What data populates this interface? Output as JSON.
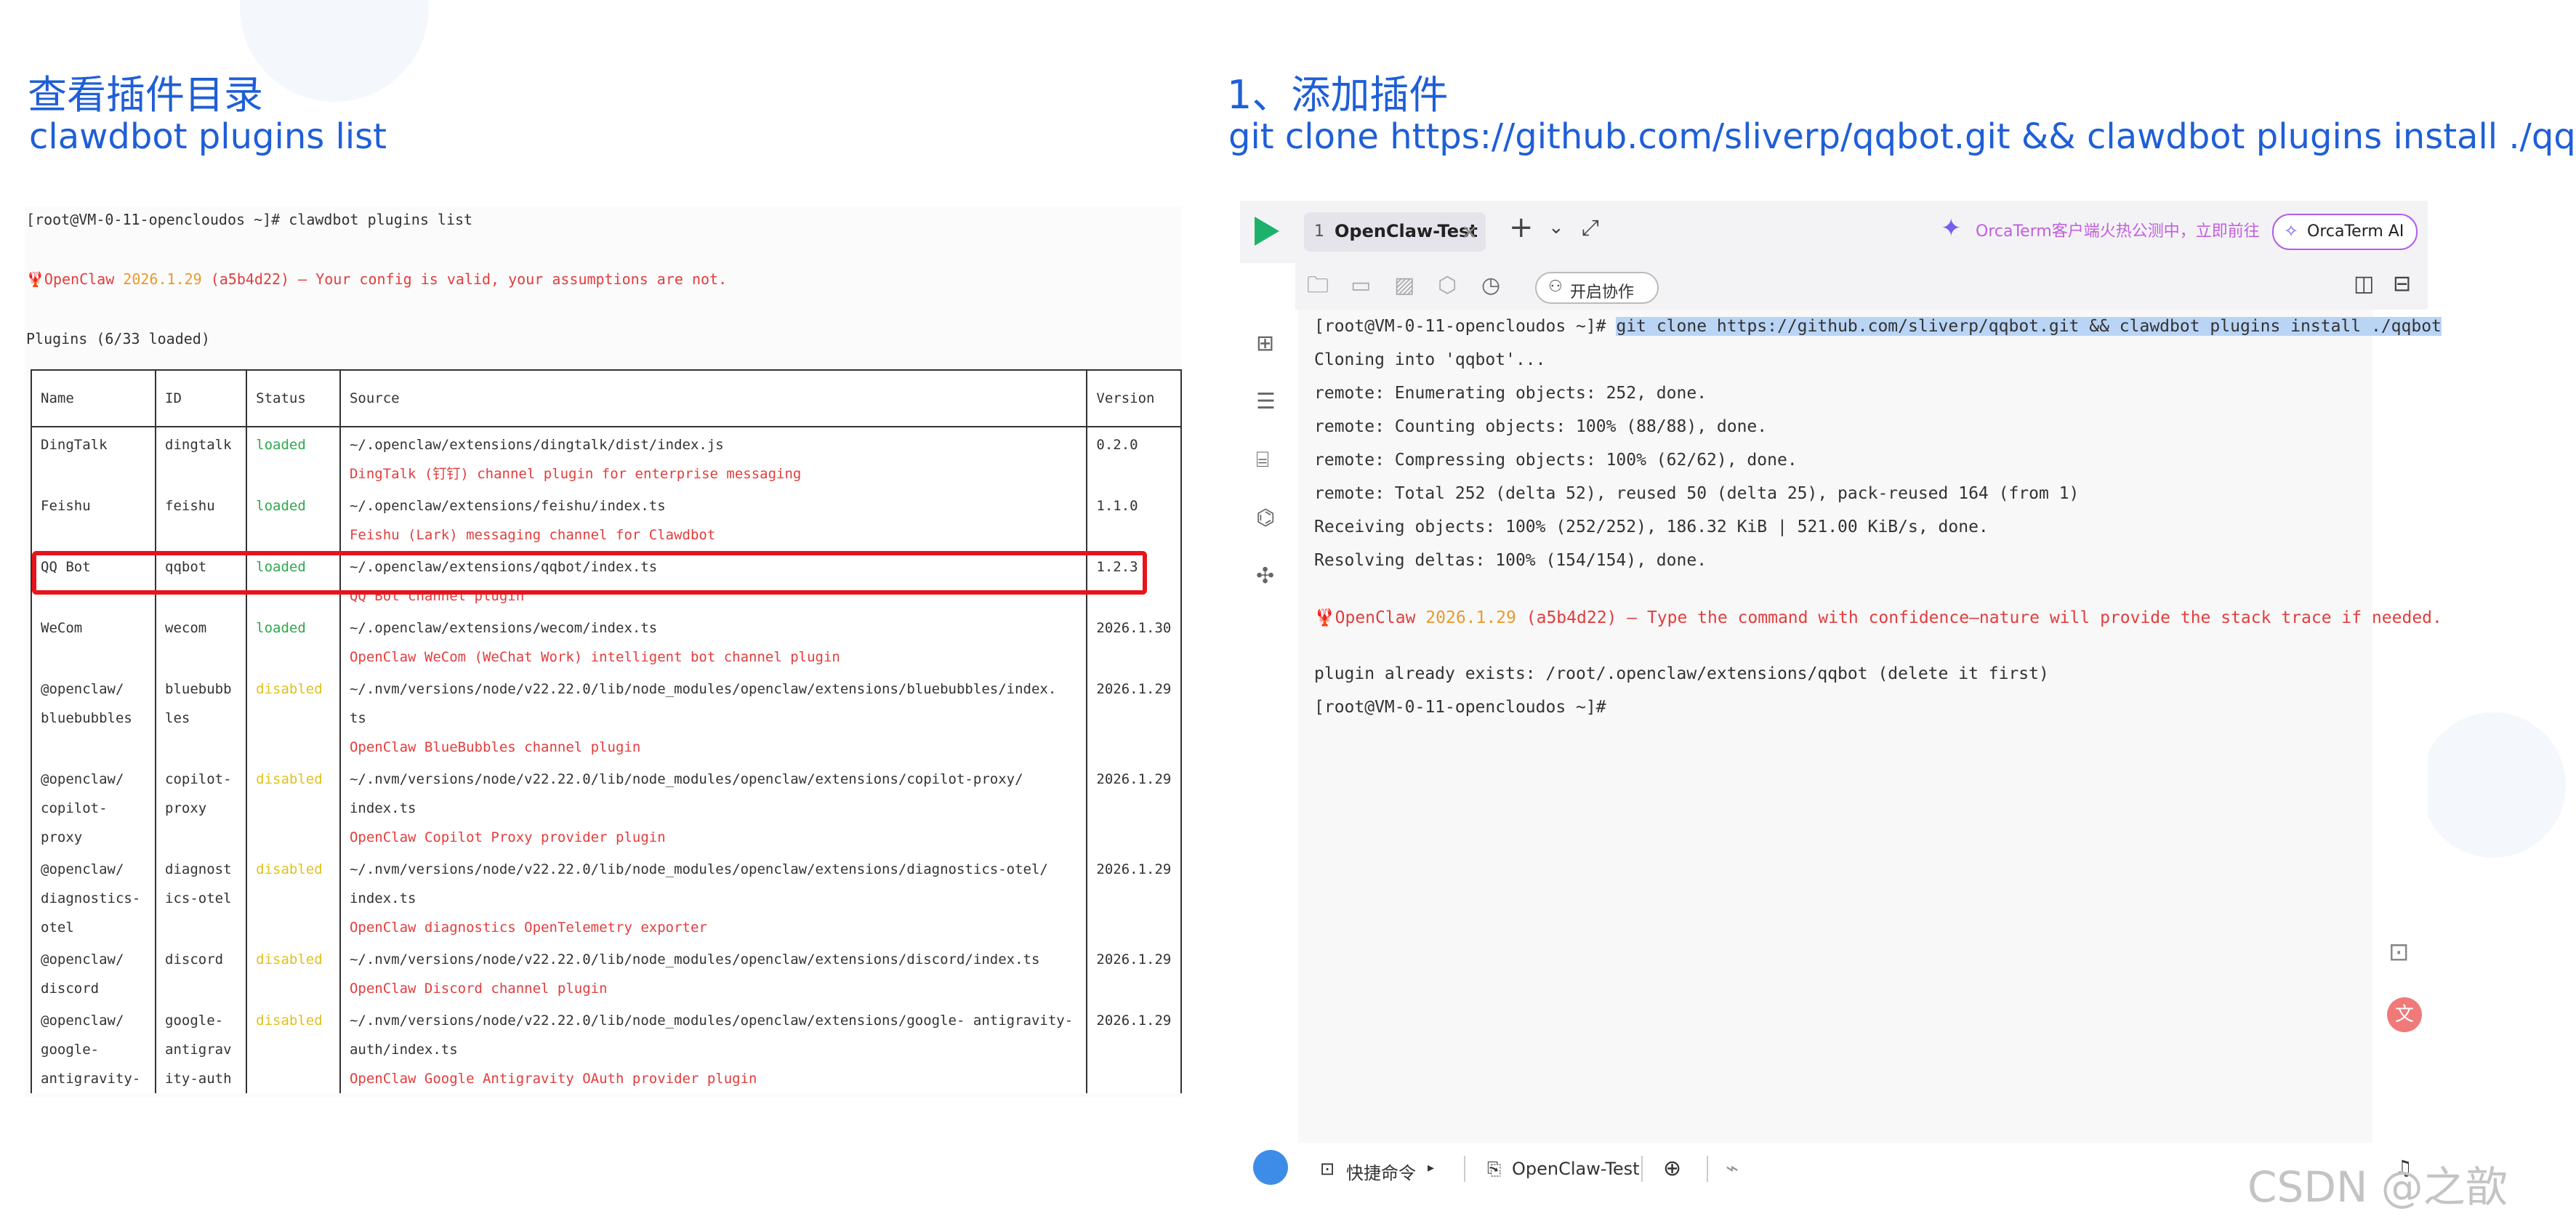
{
  "left": {
    "heading_cn": "查看插件目录",
    "heading_cmd": "clawdbot plugins list",
    "terminal": {
      "prompt_cmd": "[root@VM-0-11-opencloudos ~]# clawdbot plugins list",
      "config_line_prefix": "🦞OpenClaw",
      "config_version": "2026.1.29",
      "config_hash": "(a5b4d22)",
      "config_msg": "— Your config is valid, your assumptions are not.",
      "plugins_loaded": "Plugins (6/33 loaded)"
    },
    "table": {
      "headers": [
        "Name",
        "ID",
        "Status",
        "Source",
        "Version"
      ],
      "rows": [
        {
          "name": "DingTalk",
          "id": "dingtalk",
          "status": "loaded",
          "source": "~/.openclaw/extensions/dingtalk/dist/index.js",
          "desc": "DingTalk (钉钉) channel plugin for enterprise messaging",
          "version": "0.2.0"
        },
        {
          "name": "Feishu",
          "id": "feishu",
          "status": "loaded",
          "source": "~/.openclaw/extensions/feishu/index.ts",
          "desc": "Feishu (Lark) messaging channel for Clawdbot",
          "version": "1.1.0"
        },
        {
          "name": "QQ Bot",
          "id": "qqbot",
          "status": "loaded",
          "source": "~/.openclaw/extensions/qqbot/index.ts",
          "desc": "QQ Bot channel plugin",
          "version": "1.2.3"
        },
        {
          "name": "WeCom",
          "id": "wecom",
          "status": "loaded",
          "source": "~/.openclaw/extensions/wecom/index.ts",
          "desc": "OpenClaw WeCom (WeChat Work) intelligent bot channel plugin",
          "version": "2026.1.30"
        },
        {
          "name": "@openclaw/ bluebubbles",
          "id": "bluebubb les",
          "status": "disabled",
          "source": "~/.nvm/versions/node/v22.22.0/lib/node_modules/openclaw/extensions/bluebubbles/index. ts",
          "desc": "OpenClaw BlueBubbles channel plugin",
          "version": "2026.1.29"
        },
        {
          "name": "@openclaw/ copilot- proxy",
          "id": "copilot- proxy",
          "status": "disabled",
          "source": "~/.nvm/versions/node/v22.22.0/lib/node_modules/openclaw/extensions/copilot-proxy/ index.ts",
          "desc": "OpenClaw Copilot Proxy provider plugin",
          "version": "2026.1.29"
        },
        {
          "name": "@openclaw/ diagnostics- otel",
          "id": "diagnost ics-otel",
          "status": "disabled",
          "source": "~/.nvm/versions/node/v22.22.0/lib/node_modules/openclaw/extensions/diagnostics-otel/ index.ts",
          "desc": "OpenClaw diagnostics OpenTelemetry exporter",
          "version": "2026.1.29"
        },
        {
          "name": "@openclaw/ discord",
          "id": "discord",
          "status": "disabled",
          "source": "~/.nvm/versions/node/v22.22.0/lib/node_modules/openclaw/extensions/discord/index.ts",
          "desc": "OpenClaw Discord channel plugin",
          "version": "2026.1.29"
        },
        {
          "name": "@openclaw/ google- antigravity-",
          "id": "google- antigrav ity-auth",
          "status": "disabled",
          "source": "~/.nvm/versions/node/v22.22.0/lib/node_modules/openclaw/extensions/google- antigravity-auth/index.ts",
          "desc": "OpenClaw Google Antigravity OAuth provider plugin",
          "version": "2026.1.29"
        }
      ]
    }
  },
  "right": {
    "heading_cn": "1、添加插件",
    "heading_cmd": "git clone https://github.com/sliverp/qqbot.git && clawdbot plugins install ./qqbot",
    "tab": {
      "number": "1",
      "label": "OpenClaw-Test",
      "close": "×"
    },
    "tab_add": "+",
    "promo_text": "OrcaTerm客户端火热公测中，立即前往",
    "orcaterm_ai": "OrcaTerm AI",
    "collab_button": "开启协作",
    "terminal": {
      "prompt": "[root@VM-0-11-opencloudos ~]#",
      "command": "git clone https://github.com/sliverp/qqbot.git && clawdbot plugins install ./qqbot",
      "lines": [
        "Cloning into 'qqbot'...",
        "remote: Enumerating objects: 252, done.",
        "remote: Counting objects: 100% (88/88), done.",
        "remote: Compressing objects: 100% (62/62), done.",
        "remote: Total 252 (delta 52), reused 50 (delta 25), pack-reused 164 (from 1)",
        "Receiving objects: 100% (252/252), 186.32 KiB | 521.00 KiB/s, done.",
        "Resolving deltas: 100% (154/154), done."
      ],
      "warn_prefix": "🦞OpenClaw",
      "warn_version": "2026.1.29",
      "warn_hash": "(a5b4d22)",
      "warn_msg": "— Type the command with confidence—nature will provide the stack trace if needed.",
      "exists_line": "plugin already exists: /root/.openclaw/extensions/qqbot (delete it first)",
      "final_prompt": "[root@VM-0-11-opencloudos ~]#"
    },
    "statusbar": {
      "quick_cmd": "快捷命令",
      "session": "OpenClaw-Test"
    }
  },
  "watermark": "CSDN @之歆",
  "colors": {
    "heading_blue": "#1f5fd6",
    "highlight_red": "#e8131b",
    "selection_blue": "#b9d4f5",
    "loaded_green": "#2fa84f",
    "disabled_yellow": "#e0c020",
    "desc_red": "#e23d3d"
  }
}
